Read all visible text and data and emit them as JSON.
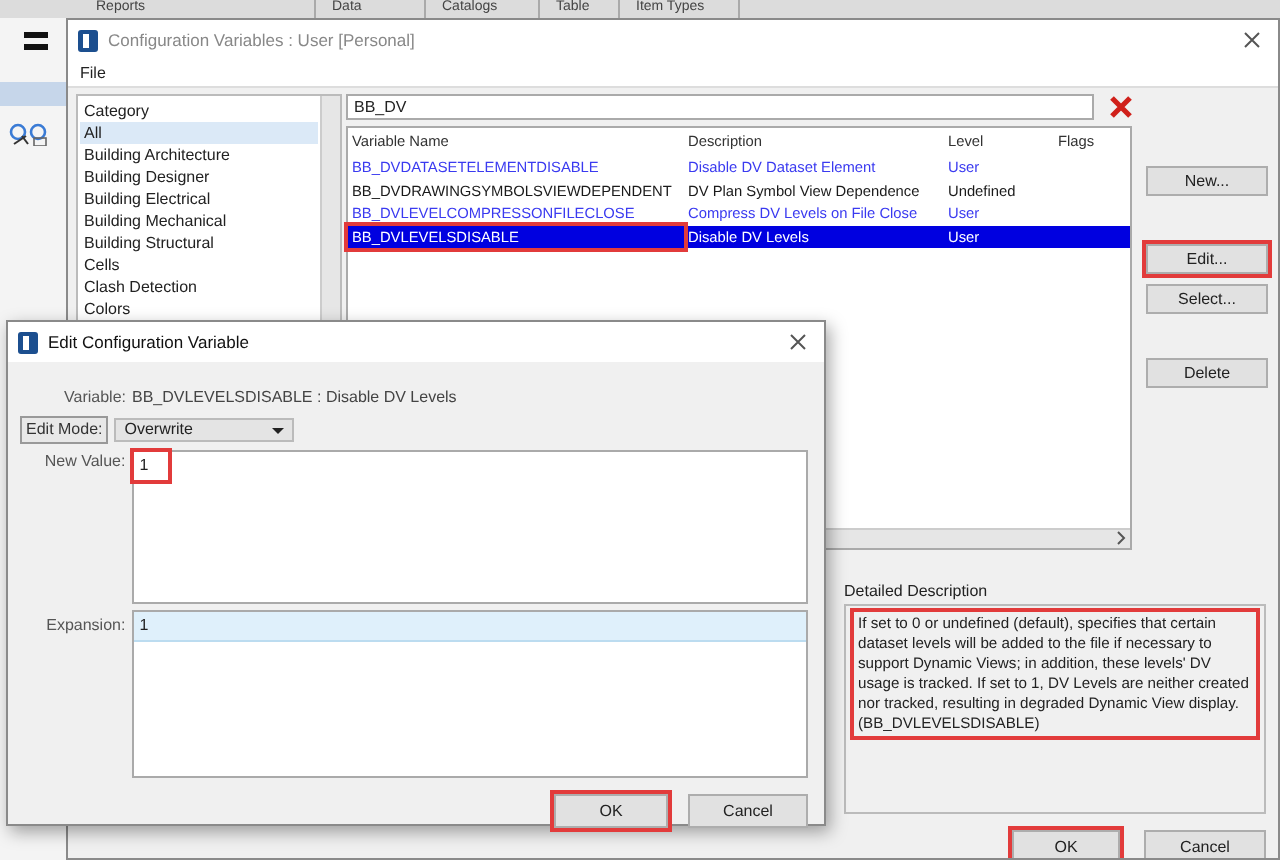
{
  "background_app": {
    "tabs": [
      "Reports",
      "Data",
      "Catalogs",
      "Table",
      "Item Types"
    ]
  },
  "config_window": {
    "title": "Configuration Variables : User [Personal]",
    "menu": [
      "File"
    ],
    "category_header": "Category",
    "categories": [
      {
        "label": "All",
        "selected": true
      },
      {
        "label": "Building Architecture",
        "selected": false
      },
      {
        "label": "Building Designer",
        "selected": false
      },
      {
        "label": "Building Electrical",
        "selected": false
      },
      {
        "label": "Building Mechanical",
        "selected": false
      },
      {
        "label": "Building Structural",
        "selected": false
      },
      {
        "label": "Cells",
        "selected": false
      },
      {
        "label": "Clash Detection",
        "selected": false
      },
      {
        "label": "Colors",
        "selected": false
      }
    ],
    "filter": {
      "value": "BB_DV"
    },
    "table": {
      "columns": [
        "Variable Name",
        "Description",
        "Level",
        "Flags"
      ],
      "rows": [
        {
          "cells": [
            "BB_DVDATASETELEMENTDISABLE",
            "Disable DV Dataset Element",
            "User",
            ""
          ],
          "color": "#3a3af0",
          "selected": false,
          "highlighted": false
        },
        {
          "cells": [
            "BB_DVDRAWINGSYMBOLSVIEWDEPENDENT",
            "DV Plan Symbol View Dependence",
            "Undefined",
            ""
          ],
          "color": "#1a1a1a",
          "selected": false,
          "highlighted": false
        },
        {
          "cells": [
            "BB_DVLEVELCOMPRESSONFILECLOSE",
            "Compress DV Levels on File Close",
            "User",
            ""
          ],
          "color": "#3a3af0",
          "selected": false,
          "highlighted": false
        },
        {
          "cells": [
            "BB_DVLEVELSDISABLE",
            "Disable DV Levels",
            "User",
            ""
          ],
          "selected": true,
          "highlighted": true
        }
      ]
    },
    "side_buttons": [
      {
        "label": "New...",
        "highlighted": false
      },
      {
        "label": "Edit...",
        "highlighted": true
      },
      {
        "label": "Select...",
        "highlighted": false
      },
      {
        "label": "Delete",
        "highlighted": false
      }
    ],
    "detailed_description": {
      "label": "Detailed Description",
      "text": "If set to 0 or undefined (default), specifies that certain dataset levels will be added to the file if necessary to support Dynamic Views; in addition, these levels' DV usage is tracked. If set to 1, DV Levels are neither created nor tracked, resulting in degraded Dynamic View display. (BB_DVLEVELSDISABLE)",
      "highlighted": true
    },
    "buttons": [
      {
        "label": "OK",
        "highlighted": true
      },
      {
        "label": "Cancel",
        "highlighted": false
      }
    ]
  },
  "edit_dialog": {
    "title": "Edit Configuration Variable",
    "variable_label": "Variable:",
    "variable_value": "BB_DVLEVELSDISABLE : Disable DV Levels",
    "edit_mode_label": "Edit Mode:",
    "edit_mode": "Overwrite",
    "new_value_label": "New Value:",
    "new_value": "1",
    "new_value_highlighted": true,
    "expansion_label": "Expansion:",
    "expansion": "1",
    "buttons": [
      {
        "label": "OK",
        "highlighted": true
      },
      {
        "label": "Cancel",
        "highlighted": false
      }
    ]
  }
}
